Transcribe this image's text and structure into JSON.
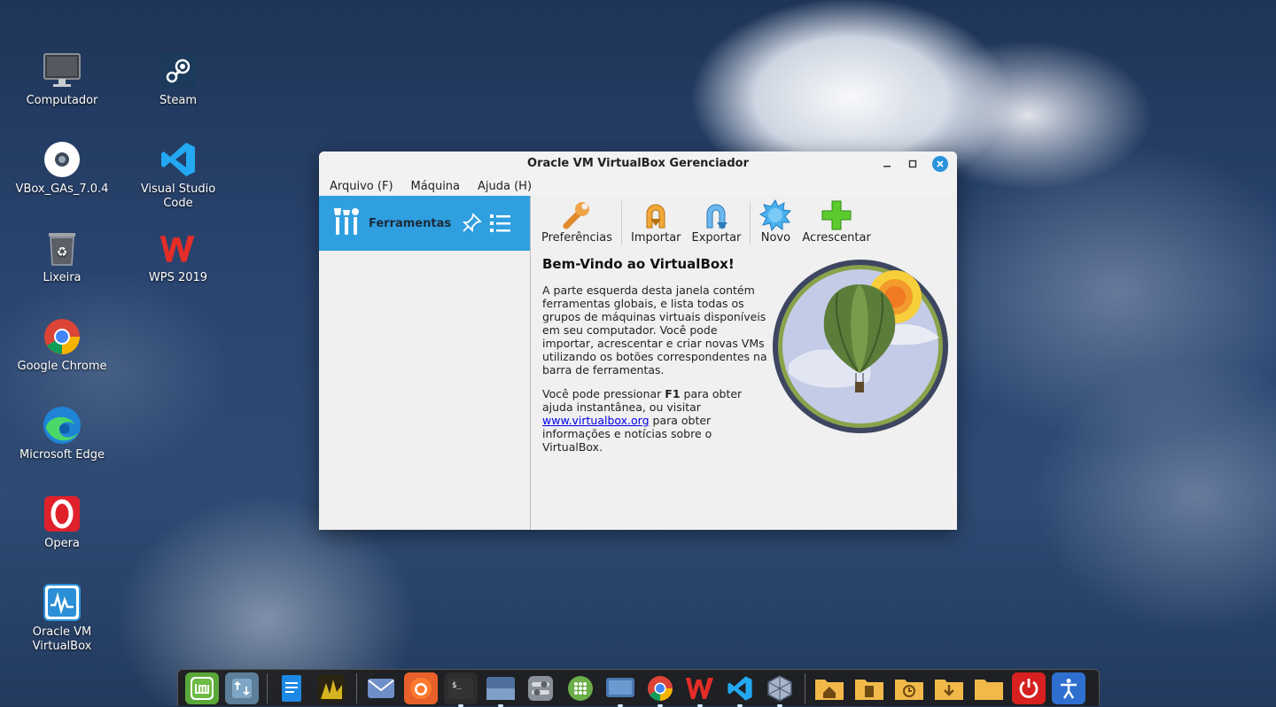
{
  "desktop": {
    "icons": [
      {
        "label": "Computador",
        "icon": "computer-icon"
      },
      {
        "label": "Steam",
        "icon": "steam-icon"
      },
      {
        "label": "VBox_GAs_7.0.4",
        "icon": "disc-icon"
      },
      {
        "label": "Visual Studio\nCode",
        "icon": "vscode-icon"
      },
      {
        "label": "Lixeira",
        "icon": "trash-icon"
      },
      {
        "label": "WPS 2019",
        "icon": "wps-icon"
      },
      {
        "label": "Google Chrome",
        "icon": "chrome-icon"
      },
      {
        "label": "Microsoft Edge",
        "icon": "edge-icon"
      },
      {
        "label": "Opera",
        "icon": "opera-icon"
      },
      {
        "label": "Oracle VM\nVirtualBox",
        "icon": "virtualbox-icon"
      }
    ]
  },
  "window": {
    "title": "Oracle VM VirtualBox Gerenciador",
    "menu": [
      "Arquivo (F)",
      "Máquina",
      "Ajuda (H)"
    ],
    "tools_label": "Ferramentas",
    "toolbar": {
      "preferences": "Preferências",
      "import": "Importar",
      "export": "Exportar",
      "new": "Novo",
      "add": "Acrescentar"
    },
    "welcome": {
      "heading": "Bem-Vindo ao VirtualBox!",
      "p1": "A parte esquerda desta janela contém ferramentas globais, e lista todas os grupos de máquinas virtuais disponíveis em seu computador. Você pode importar, acrescentar e criar novas VMs utilizando os botões correspondentes na barra de ferramentas.",
      "p2_before": "Você pode pressionar ",
      "p2_key": "F1",
      "p2_mid": " para obter ajuda instantânea, ou visitar ",
      "p2_link": "www.virtualbox.org",
      "p2_after": " para obter informações e notícias sobre o VirtualBox."
    }
  },
  "colors": {
    "accent": "#2f9fe0",
    "close_button": "#2b93dc",
    "link": "#0000ee"
  },
  "taskbar": {
    "items": [
      "mint-menu-icon",
      "update-manager-icon",
      "text-editor-icon",
      "image-viewer-icon",
      "mail-icon",
      "firefox-icon",
      "terminal-icon",
      "desktop-icon",
      "settings-icon",
      "apps-icon",
      "display-icon",
      "chrome-icon",
      "wps-icon",
      "vscode-icon",
      "virtualbox-icon",
      "home-folder-icon",
      "documents-folder-icon",
      "recent-folder-icon",
      "downloads-folder-icon",
      "folder-icon",
      "power-icon",
      "accessibility-icon"
    ]
  }
}
